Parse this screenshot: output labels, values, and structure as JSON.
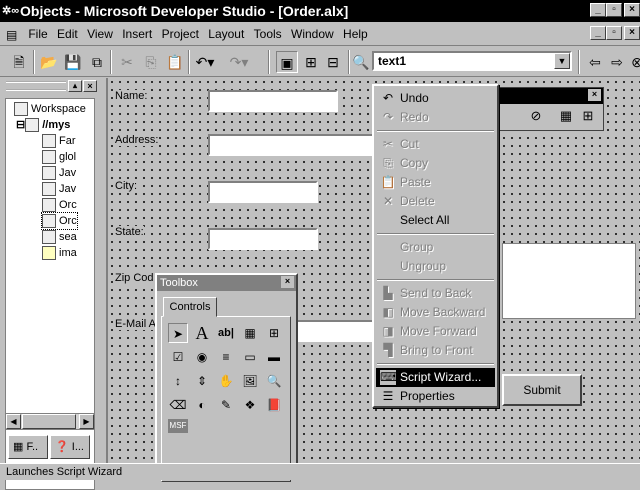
{
  "window": {
    "title": "Objects - Microsoft Developer Studio - [Order.alx]"
  },
  "menubar": {
    "items": [
      "File",
      "Edit",
      "View",
      "Insert",
      "Project",
      "Layout",
      "Tools",
      "Window",
      "Help"
    ]
  },
  "toolbar": {
    "combo_value": "text1"
  },
  "workspace": {
    "items": [
      {
        "label": "Workspace"
      },
      {
        "label": "//mys"
      },
      {
        "label": "Far"
      },
      {
        "label": "glol"
      },
      {
        "label": "Jav"
      },
      {
        "label": "Jav"
      },
      {
        "label": "Orc"
      },
      {
        "label": "Orc"
      },
      {
        "label": "sea"
      },
      {
        "label": "ima"
      }
    ],
    "tabs": [
      "F..",
      "I..."
    ]
  },
  "form": {
    "labels": [
      "Name:",
      "Address:",
      "City:",
      "State:",
      "Zip Cod",
      "E-Mail A"
    ],
    "submit_label": "Submit"
  },
  "toolbox": {
    "title": "Toolbox",
    "tab": "Controls",
    "tools": [
      "arrow-pointer",
      "A",
      "ab|",
      "list",
      "grid",
      "☑",
      "◉",
      "≡",
      "▭",
      "▬",
      "↕",
      "⇕",
      "✋",
      "img",
      "mag",
      "eraser",
      "◐",
      "pen",
      "cubes",
      "book",
      "MSF"
    ]
  },
  "context_menu": {
    "items": [
      {
        "label": "Undo",
        "icon": "undo-icon",
        "enabled": true
      },
      {
        "label": "Redo",
        "icon": "redo-icon",
        "enabled": false
      },
      {
        "label": "Cut",
        "icon": "cut-icon",
        "enabled": false
      },
      {
        "label": "Copy",
        "icon": "copy-icon",
        "enabled": false
      },
      {
        "label": "Paste",
        "icon": "paste-icon",
        "enabled": false
      },
      {
        "label": "Delete",
        "icon": "delete-icon",
        "enabled": false
      },
      {
        "label": "Select All",
        "icon": "",
        "enabled": true
      },
      {
        "label": "Group",
        "icon": "",
        "enabled": false
      },
      {
        "label": "Ungroup",
        "icon": "",
        "enabled": false
      },
      {
        "label": "Send to Back",
        "icon": "send-back-icon",
        "enabled": false
      },
      {
        "label": "Move Backward",
        "icon": "move-backward-icon",
        "enabled": false
      },
      {
        "label": "Move Forward",
        "icon": "move-forward-icon",
        "enabled": false
      },
      {
        "label": "Bring to Front",
        "icon": "bring-front-icon",
        "enabled": false
      },
      {
        "label": "Script Wizard...",
        "icon": "script-wizard-icon",
        "enabled": true,
        "selected": true
      },
      {
        "label": "Properties",
        "icon": "properties-icon",
        "enabled": true
      }
    ]
  },
  "status": {
    "text": "Launches Script Wizard"
  }
}
